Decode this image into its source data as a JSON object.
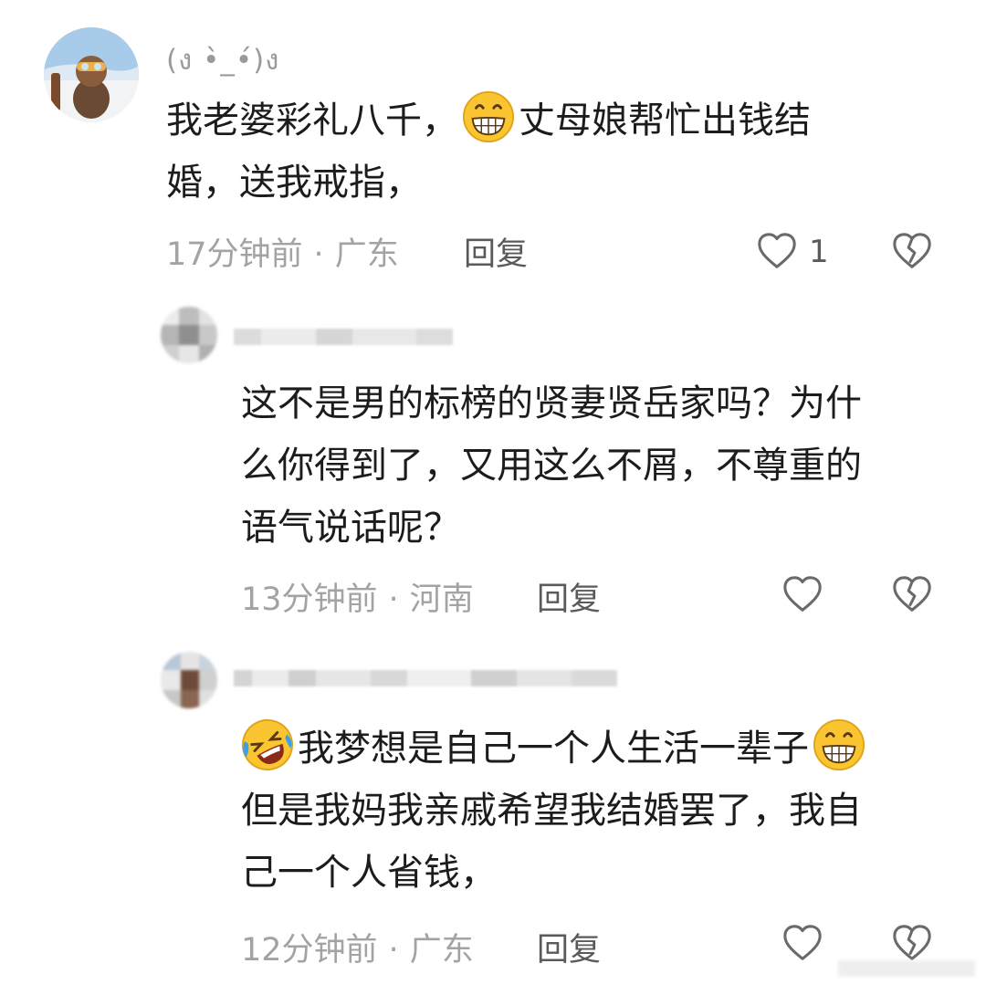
{
  "comments": [
    {
      "username": "(ง •̀_•́)ง",
      "text_line1_a": "我老婆彩礼八千，",
      "text_line1_b": "丈母娘帮忙出钱结",
      "text_line2": "婚，送我戒指，",
      "time": "17分钟前",
      "location": "广东",
      "reply_label": "回复",
      "like_count": "1",
      "emoji_inline": "grin-emoji"
    },
    {
      "username": "",
      "text_line1": "这不是男的标榜的贤妻贤岳家吗？为什",
      "text_line2": "么你得到了，又用这么不屑，不尊重的",
      "text_line3": "语气说话呢？",
      "time": "13分钟前",
      "location": "河南",
      "reply_label": "回复"
    },
    {
      "username": "",
      "text_line1": "我梦想是自己一个人生活一辈子",
      "text_line2": "但是我妈我亲戚希望我结婚罢了，我自",
      "text_line3": "己一个人省钱，",
      "time": "12分钟前",
      "location": "广东",
      "reply_label": "回复",
      "emoji_start": "rofl-emoji",
      "emoji_end": "grin-emoji"
    }
  ],
  "meta_separator": "·",
  "icons": {
    "like": "heart-outline-icon",
    "dislike": "broken-heart-icon"
  },
  "colors": {
    "text": "#1c1c1c",
    "meta": "#a3a3a3",
    "icon": "#6a6a6a"
  }
}
